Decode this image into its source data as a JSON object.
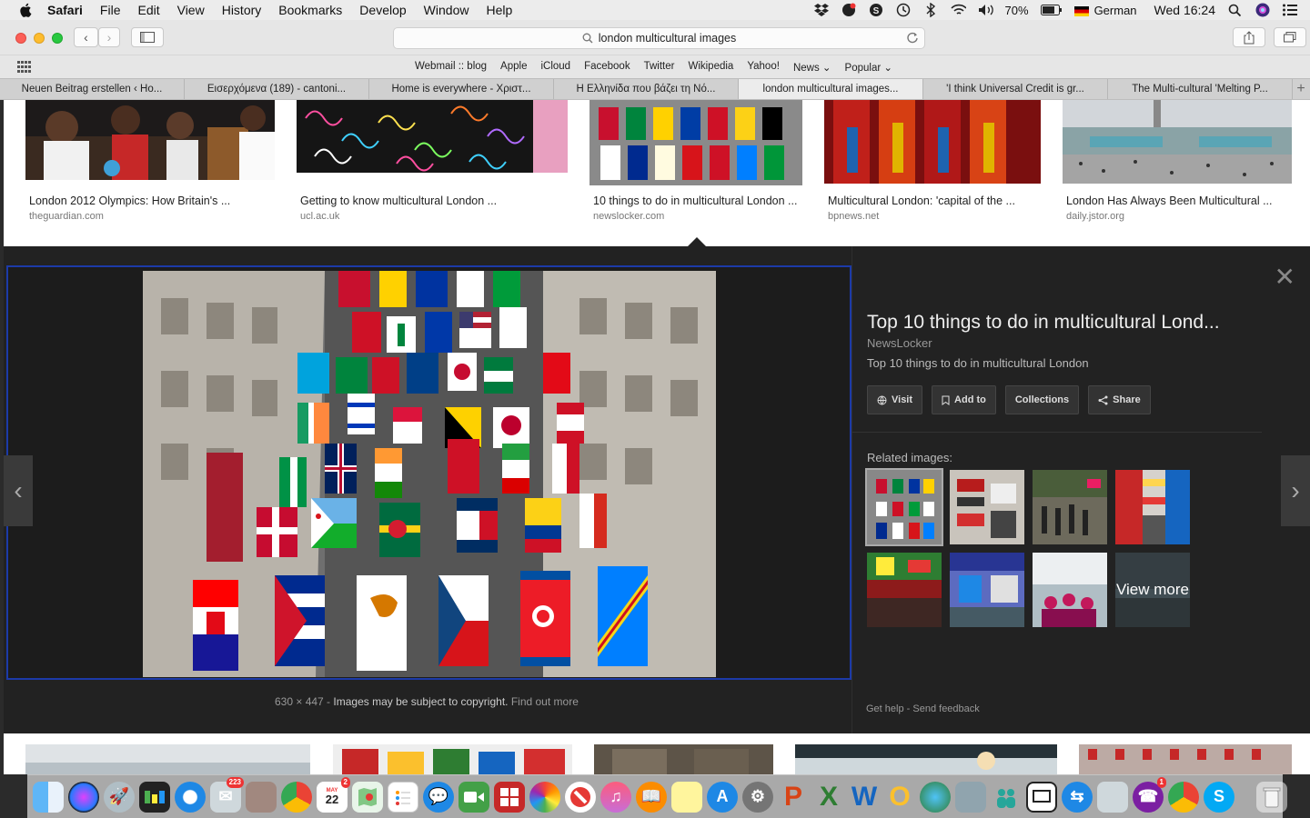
{
  "menubar": {
    "app": "Safari",
    "items": [
      "File",
      "Edit",
      "View",
      "History",
      "Bookmarks",
      "Develop",
      "Window",
      "Help"
    ],
    "battery": "70%",
    "input_source": "German",
    "clock": "Wed 16:24"
  },
  "toolbar": {
    "url": "london multicultural images"
  },
  "bookmarks": [
    "Webmail :: blog",
    "Apple",
    "iCloud",
    "Facebook",
    "Twitter",
    "Wikipedia",
    "Yahoo!",
    "News",
    "Popular"
  ],
  "tabs": [
    "Neuen Beitrag erstellen ‹ Ho...",
    "Εισερχόμενα (189) - cantoni...",
    "Home is everywhere - Χριστ...",
    "Η Ελληνίδα που βάζει τη Νό...",
    "london multicultural images...",
    "'I think Universal Credit is gr...",
    "The Multi-cultural 'Melting P..."
  ],
  "results": [
    {
      "caption": "London 2012 Olympics: How Britain's ...",
      "source": "theguardian.com"
    },
    {
      "caption": "Getting to know multicultural London ...",
      "source": "ucl.ac.uk"
    },
    {
      "caption": "10 things to do in multicultural London ...",
      "source": "newslocker.com"
    },
    {
      "caption": "Multicultural London: 'capital of the ...",
      "source": "bpnews.net"
    },
    {
      "caption": "London Has Always Been Multicultural ...",
      "source": "daily.jstor.org"
    }
  ],
  "preview": {
    "dimensions": "630 × 447",
    "copyright": "Images may be subject to copyright.",
    "find_out_more": "Find out more",
    "title": "Top 10 things to do in multicultural Lond...",
    "site": "NewsLocker",
    "description": "Top 10 things to do in multicultural London",
    "actions": {
      "visit": "Visit",
      "add_to": "Add to",
      "collections": "Collections",
      "share": "Share"
    },
    "related_label": "Related images:",
    "view_more": "View more",
    "get_help": "Get help",
    "sep": "-",
    "send_feedback": "Send feedback"
  },
  "dock": {
    "mail_badge": "223",
    "calendar_month": "MAY",
    "calendar_day": "22",
    "calendar_badge": "2",
    "viber_badge": "1"
  },
  "colors": {
    "accent_frame": "#1c3aa8",
    "panel_bg": "#222222",
    "menubar_bg": "#ececec"
  }
}
